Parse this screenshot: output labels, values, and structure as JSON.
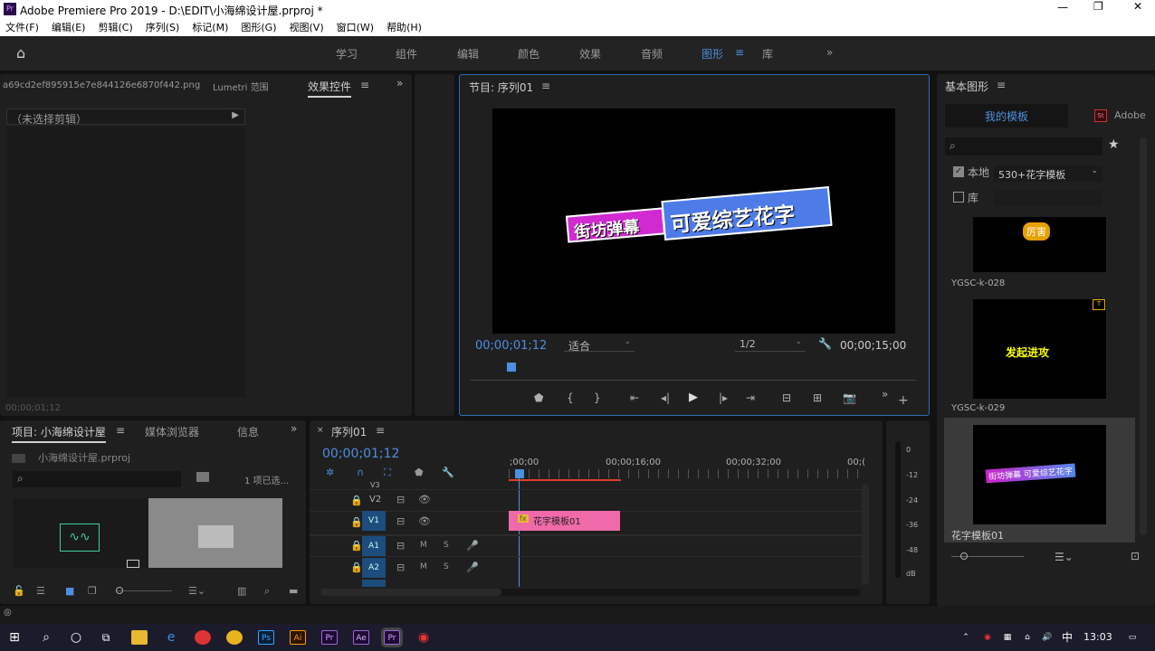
{
  "window": {
    "title": "Adobe Premiere Pro 2019 - D:\\EDIT\\小海绵设计屋.prproj *",
    "app_icon": "Pr"
  },
  "menu": [
    "文件(F)",
    "编辑(E)",
    "剪辑(C)",
    "序列(S)",
    "标记(M)",
    "图形(G)",
    "视图(V)",
    "窗口(W)",
    "帮助(H)"
  ],
  "workspaces": [
    "学习",
    "组件",
    "编辑",
    "颜色",
    "效果",
    "音频",
    "图形",
    "库"
  ],
  "active_workspace": "图形",
  "source_panel": {
    "tabs": [
      "a69cd2ef895915e7e844126e6870f442.png",
      "Lumetri 范围",
      "效果控件"
    ],
    "active_tab": "效果控件",
    "clip_select": "（未选择剪辑）",
    "timecode": "00;00;01;12"
  },
  "program_monitor": {
    "title": "节目: 序列01",
    "timecode": "00;00;01;12",
    "fit": "适合",
    "resolution": "1/2",
    "duration": "00;00;15;00",
    "overlay_left": "街坊弹幕",
    "overlay_right": "可爱综艺花字"
  },
  "project_panel": {
    "tabs": [
      "项目: 小海绵设计屋",
      "媒体浏览器",
      "信息"
    ],
    "file": "小海绵设计屋.prproj",
    "selected_count": "1 项已选..."
  },
  "timeline": {
    "tab": "序列01",
    "timecode": "00;00;01;12",
    "ruler": [
      ";00;00",
      "00;00;16;00",
      "00;00;32;00",
      "00;("
    ],
    "tracks": [
      {
        "name": "V3"
      },
      {
        "name": "V2",
        "toggles": [
          "lock",
          "film",
          "eye"
        ]
      },
      {
        "name": "V1",
        "toggles": [
          "lock",
          "film",
          "eye"
        ]
      },
      {
        "name": "A1",
        "m": "M",
        "s": "S"
      },
      {
        "name": "A2",
        "m": "M",
        "s": "S"
      }
    ],
    "clip": {
      "label": "花字模板01",
      "badge": "fx",
      "color": "#f06aa9"
    }
  },
  "audio_meter": {
    "labels": [
      "0",
      "-12",
      "-24",
      "-36",
      "-48",
      "dB"
    ]
  },
  "essential_graphics": {
    "title": "基本图形",
    "tabs": [
      "我的模板",
      "Adobe"
    ],
    "active_tab": "我的模板",
    "local_label": "本地",
    "local_checked": true,
    "local_folder": "530+花字模板",
    "library_label": "库",
    "library_checked": false,
    "items": [
      {
        "name": "YGSC-k-028",
        "thumb_text": "厉害"
      },
      {
        "name": "YGSC-k-029",
        "thumb_text": "发起进攻"
      },
      {
        "name": "花字模板01",
        "thumb_text": "街坊弹幕 可爱综艺花字",
        "selected": true
      }
    ]
  },
  "taskbar": {
    "time": "13:03",
    "ime": "中",
    "apps": [
      "Ps",
      "Ai",
      "Pr",
      "Ae",
      "Pr"
    ]
  },
  "colors": {
    "accent": "#4d8fe0",
    "clip": "#f06aa9",
    "work_area": "#e0402a"
  }
}
